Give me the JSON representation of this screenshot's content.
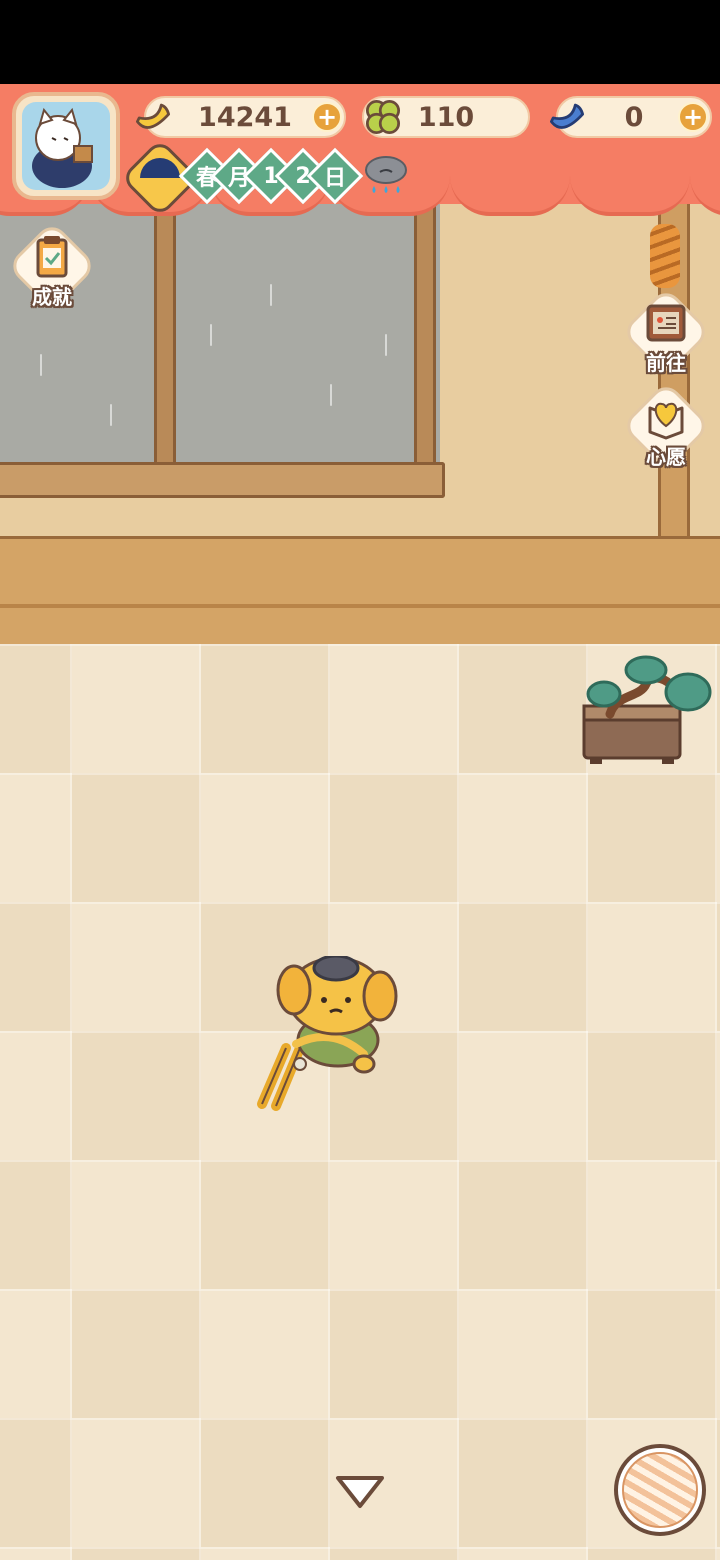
{
  "hud": {
    "bananas": "14241",
    "clovers": "110",
    "blue_bananas": "0",
    "plus_symbol": "+",
    "date": {
      "season": "春",
      "month_char": "月",
      "day_digit_1": "1",
      "day_digit_2": "2",
      "day_char": "日"
    },
    "weather_icon": "rain-cloud-icon"
  },
  "side_buttons": {
    "achievements": "成就",
    "go_to": "前往",
    "wishes": "心愿"
  },
  "colors": {
    "banner": "#f57d64",
    "banner_shadow": "#e66a52",
    "resource_pill": "#fbeed8",
    "plus_button": "#e7a23b",
    "date_chip": "#5ea987",
    "text_dark": "#6b4b3a"
  }
}
